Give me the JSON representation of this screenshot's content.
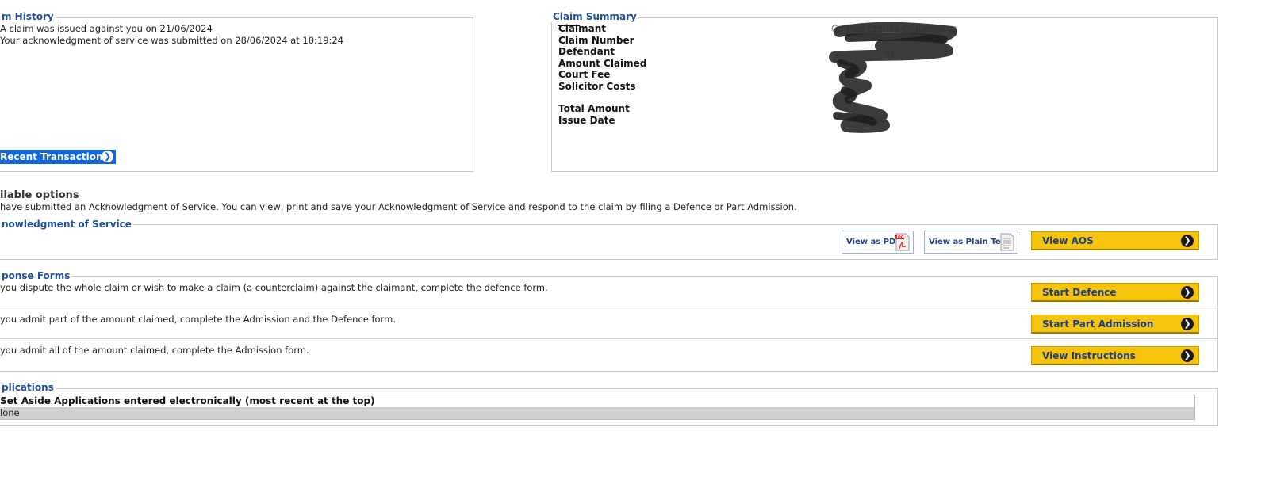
{
  "claim_history": {
    "legend": "m History",
    "lines": [
      "A claim was issued against you on 21/06/2024",
      "Your acknowledgment of service was submitted on 28/06/2024 at 10:19:24"
    ],
    "recent_transactions_label": "Recent Transactions"
  },
  "claim_summary": {
    "legend": "Claim Summary",
    "labels": {
      "claimant": "Claimant",
      "claim_number": "Claim Number",
      "defendant": "Defendant",
      "amount_claimed": "Amount Claimed",
      "court_fee": "Court Fee",
      "solicitor_costs": "Solicitor Costs",
      "total_amount": "Total Amount",
      "issue_date": "Issue Date"
    },
    "values": {
      "claimant": "Cp Plus Ltd T/a Groupnexus",
      "defendant_partial": "ey",
      "issue_date_partial": "2024"
    }
  },
  "available_options": {
    "heading": "ilable options",
    "description": "have submitted an Acknowledgment of Service. You can view, print and save your Acknowledgment of Service and respond to the claim by filing a Defence or Part Admission."
  },
  "aos": {
    "legend": "nowledgment of Service",
    "view_pdf_label": "View as PDF",
    "view_plain_label": "View as Plain Text",
    "view_aos_label": "View AOS"
  },
  "response_forms": {
    "legend": "ponse Forms",
    "rows": [
      {
        "text": "you dispute the whole claim or wish to make a claim (a counterclaim) against the claimant, complete the defence form.",
        "button": "Start Defence"
      },
      {
        "text": "you admit part of the amount claimed, complete the Admission and the Defence form.",
        "button": "Start Part Admission"
      },
      {
        "text": "you admit all of the amount claimed, complete the Admission form.",
        "button": "View Instructions"
      }
    ]
  },
  "applications": {
    "legend": "plications",
    "table_header": "Set Aside Applications entered electronically (most recent at the top)",
    "row_value": "lone"
  },
  "icons": {
    "chevron": "chevron-right-icon",
    "pdf": "pdf-document-icon",
    "text": "text-document-icon"
  },
  "colors": {
    "legend_blue": "#1f4f9e",
    "button_yellow": "#f6c30d",
    "button_blue": "#1166dd"
  }
}
